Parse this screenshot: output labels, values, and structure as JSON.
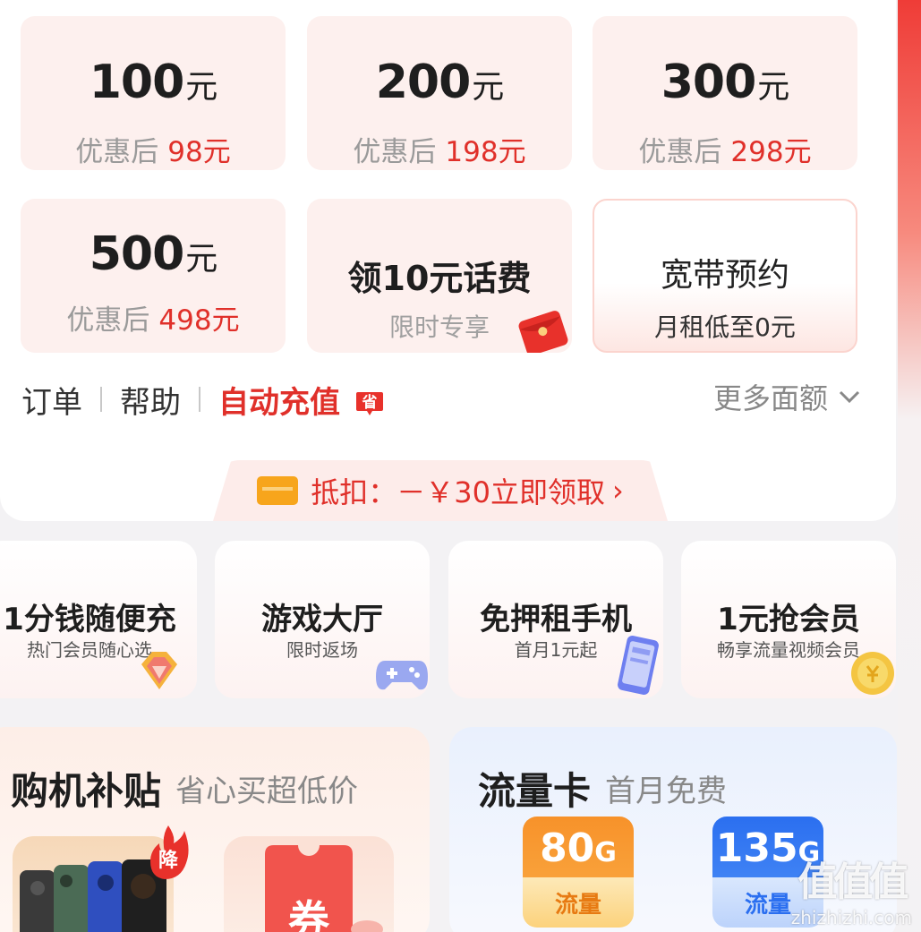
{
  "recharge": {
    "tiles": [
      {
        "amount": "100",
        "unit": "元",
        "after_label": "优惠后",
        "after_price": "98元"
      },
      {
        "amount": "200",
        "unit": "元",
        "after_label": "优惠后",
        "after_price": "198元"
      },
      {
        "amount": "300",
        "unit": "元",
        "after_label": "优惠后",
        "after_price": "298元"
      },
      {
        "amount": "500",
        "unit": "元",
        "after_label": "优惠后",
        "after_price": "498元"
      }
    ],
    "bill_tile": {
      "title": "领10元话费",
      "subtitle": "限时专享"
    },
    "broadband_tile": {
      "title": "宽带预约",
      "subtitle": "月租低至0元"
    }
  },
  "links": {
    "orders": "订单",
    "help": "帮助",
    "auto_recharge": "自动充值",
    "save_badge": "省",
    "more": "更多面额"
  },
  "coupon_bar": {
    "text": "抵扣：－￥30立即领取",
    "arrow": "›"
  },
  "features": [
    {
      "title": "1分钱随便充",
      "subtitle": "热门会员随心选",
      "icon": "gem-icon"
    },
    {
      "title": "游戏大厅",
      "subtitle": "限时返场",
      "icon": "gamepad-icon"
    },
    {
      "title": "免押租手机",
      "subtitle": "首月1元起",
      "icon": "phone-icon"
    },
    {
      "title": "1元抢会员",
      "subtitle": "畅享流量视频会员",
      "icon": "coin-icon"
    }
  ],
  "promo_left": {
    "title": "购机补贴",
    "subtitle": "省心买超低价",
    "badge": "降",
    "coupon_char": "券"
  },
  "promo_right": {
    "title": "流量卡",
    "subtitle": "首月免费",
    "cards": [
      {
        "amount": "80",
        "unit": "G",
        "label": "流量"
      },
      {
        "amount": "135",
        "unit": "G",
        "label": "流量"
      }
    ]
  },
  "watermark": {
    "glyphs": "值值值",
    "url": "zhizhizhi.com"
  },
  "colors": {
    "accent_red": "#e0302a",
    "tile_bg": "#fdf0ee",
    "orange": "#f7a51c",
    "blue": "#2b6ff0"
  }
}
